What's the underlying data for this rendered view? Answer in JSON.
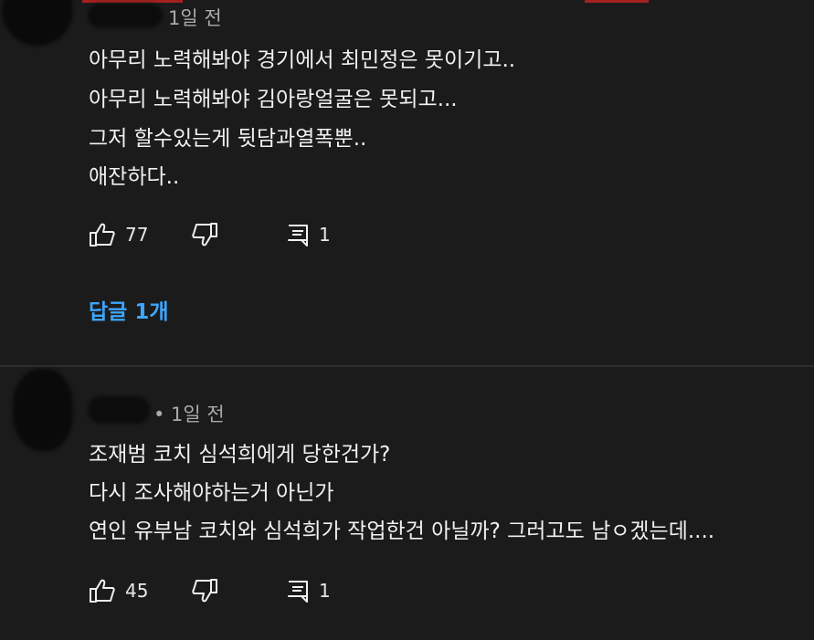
{
  "comments": [
    {
      "time": "1일 전",
      "lines": [
        "아무리 노력해봐야 경기에서 최민정은 못이기고..",
        "아무리 노력해봐야 김아랑얼굴은 못되고...",
        "그저 할수있는게 뒷담과열폭뿐..",
        "애잔하다.."
      ],
      "like_count": "77",
      "reply_count": "1",
      "replies_link": "답글 1개"
    },
    {
      "time": "• 1일 전",
      "lines": [
        "조재범 코치 심석희에게 당한건가?",
        "다시 조사해야하는거 아닌가",
        "연인 유부남 코치와 심석희가 작업한건 아닐까? 그러고도 남ㅇ겠는데...."
      ],
      "like_count": "45",
      "reply_count": "1"
    }
  ],
  "colors": {
    "background": "#1b1b1b",
    "text": "#f1f1f1",
    "meta": "#aaaaaa",
    "link": "#3ea6ff"
  }
}
